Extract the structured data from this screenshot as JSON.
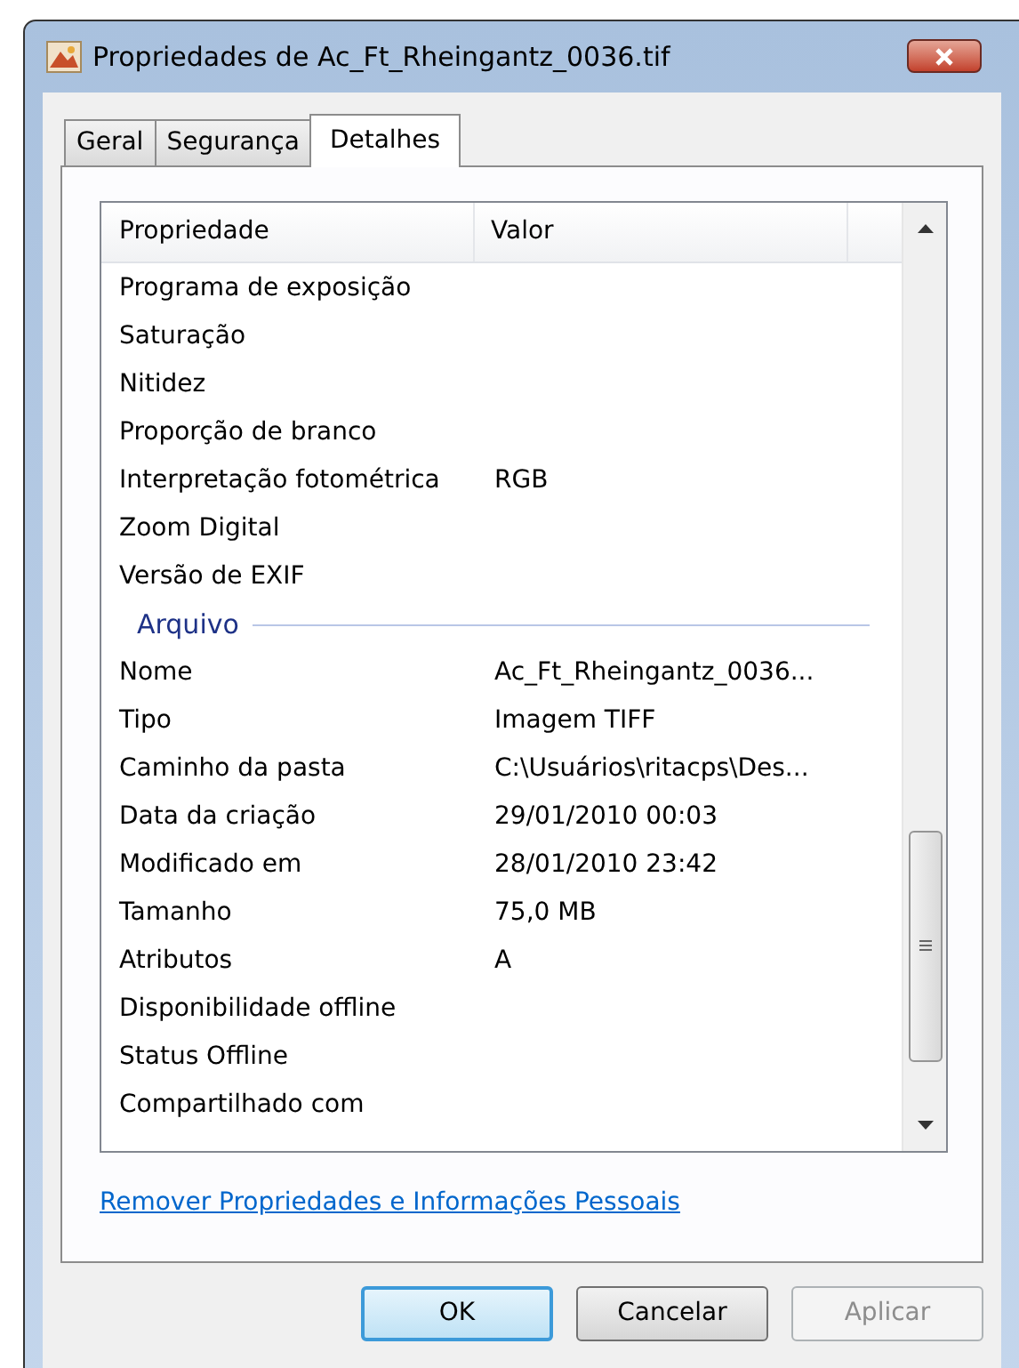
{
  "window": {
    "title": "Propriedades de Ac_Ft_Rheingantz_0036.tif"
  },
  "tabs": [
    {
      "label": "Geral",
      "selected": false
    },
    {
      "label": "Segurança",
      "selected": false
    },
    {
      "label": "Detalhes",
      "selected": true
    }
  ],
  "table": {
    "columns": [
      "Propriedade",
      "Valor"
    ],
    "rows": [
      {
        "kind": "row",
        "property": "Programa de exposição"
      },
      {
        "kind": "row",
        "property": "Saturação"
      },
      {
        "kind": "row",
        "property": "Nitidez"
      },
      {
        "kind": "row",
        "property": "Proporção de branco"
      },
      {
        "kind": "row",
        "property": "Interpretação fotométrica",
        "value": "RGB"
      },
      {
        "kind": "row",
        "property": "Zoom Digital"
      },
      {
        "kind": "row",
        "property": "Versão de EXIF"
      },
      {
        "kind": "group",
        "property": "Arquivo"
      },
      {
        "kind": "row",
        "property": "Nome",
        "value": "Ac_Ft_Rheingantz_0036..."
      },
      {
        "kind": "row",
        "property": "Tipo",
        "value": "Imagem TIFF"
      },
      {
        "kind": "row",
        "property": "Caminho da pasta",
        "value": "C:\\Usuários\\ritacps\\Des..."
      },
      {
        "kind": "row",
        "property": "Data da criação",
        "value": "29/01/2010 00:03"
      },
      {
        "kind": "row",
        "property": "Modificado em",
        "value": "28/01/2010 23:42"
      },
      {
        "kind": "row",
        "property": "Tamanho",
        "value": "75,0 MB"
      },
      {
        "kind": "row",
        "property": "Atributos",
        "value": "A"
      },
      {
        "kind": "row",
        "property": "Disponibilidade offline"
      },
      {
        "kind": "row",
        "property": "Status Offline"
      },
      {
        "kind": "row",
        "property": "Compartilhado com"
      }
    ]
  },
  "link": "Remover Propriedades e Informações Pessoais",
  "buttons": [
    {
      "label": "OK",
      "default": true,
      "disabled": false
    },
    {
      "label": "Cancelar",
      "default": false,
      "disabled": false
    },
    {
      "label": "Aplicar",
      "default": false,
      "disabled": true
    }
  ]
}
